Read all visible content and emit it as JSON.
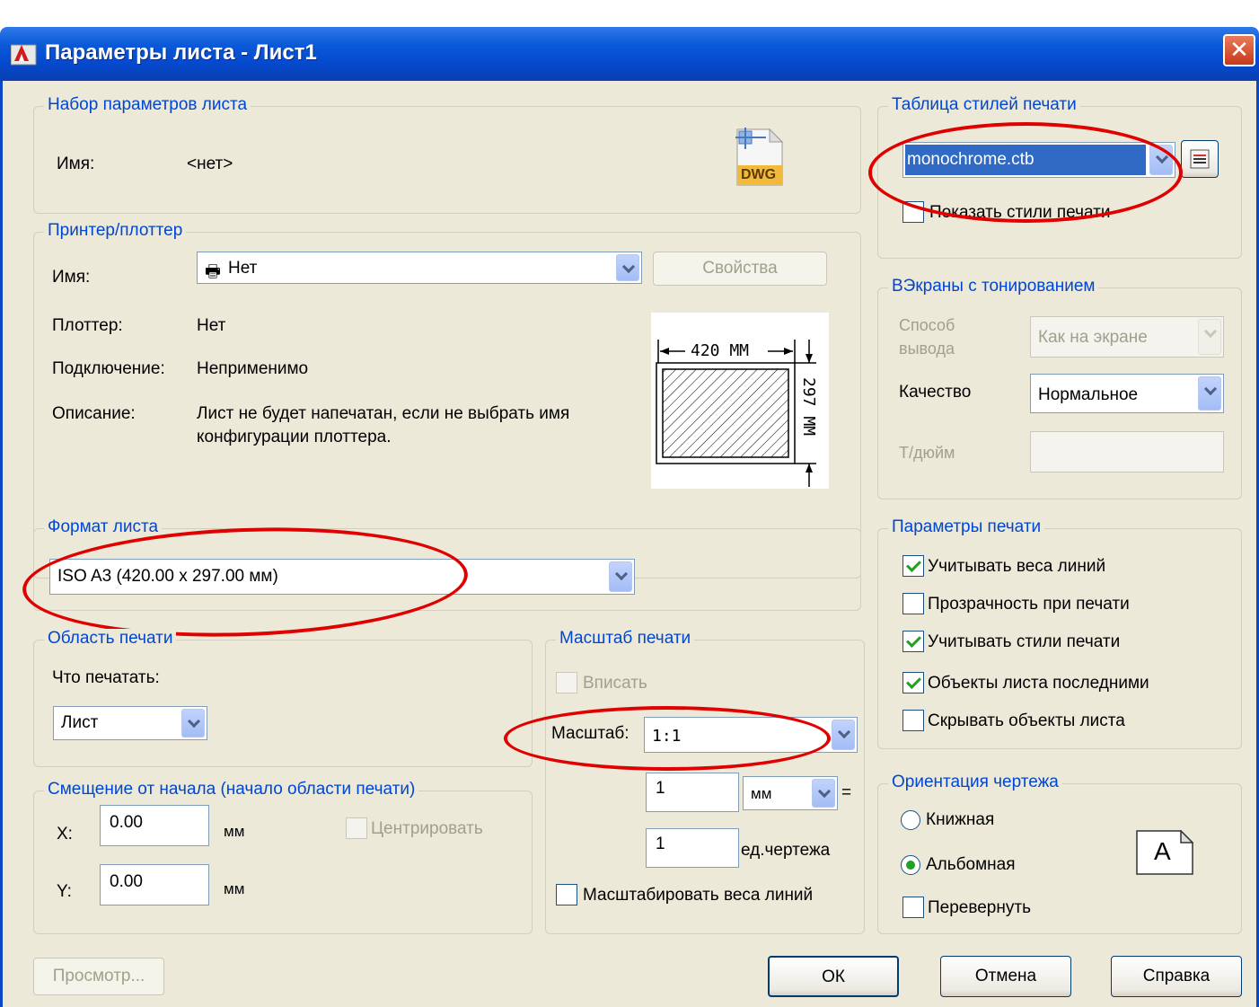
{
  "window": {
    "title": "Параметры листа - Лист1",
    "close": "✕"
  },
  "page_setup": {
    "group": "Набор параметров листа",
    "name_label": "Имя:",
    "name_value": "<нет>",
    "dwg_icon_text": "DWG"
  },
  "printer": {
    "group": "Принтер/плоттер",
    "name_label": "Имя:",
    "name_value": "Нет",
    "properties_button": "Свойства",
    "plotter_label": "Плоттер:",
    "plotter_value": "Нет",
    "connection_label": "Подключение:",
    "connection_value": "Неприменимо",
    "description_label": "Описание:",
    "description_line1": "Лист не будет напечатан, если не выбрать имя",
    "description_line2": "конфигурации плоттера.",
    "preview_width": "420 ММ",
    "preview_height": "297 ММ"
  },
  "paper_size": {
    "group": "Формат листа",
    "value": "ISO A3 (420.00 x 297.00 мм)"
  },
  "plot_area": {
    "group": "Область печати",
    "what_label": "Что печатать:",
    "what_value": "Лист"
  },
  "plot_offset": {
    "group": "Смещение от начала (начало области печати)",
    "x_label": "X:",
    "x_value": "0.00",
    "x_unit": "мм",
    "y_label": "Y:",
    "y_value": "0.00",
    "y_unit": "мм",
    "center_label": "Центрировать"
  },
  "plot_scale": {
    "group": "Масштаб печати",
    "fit_label": "Вписать",
    "scale_label": "Масштаб:",
    "scale_value": "1:1",
    "value1": "1",
    "unit_value": "мм",
    "equals": "=",
    "value2": "1",
    "drawing_units": "ед.чертежа",
    "scale_lineweights": "Масштабировать веса линий"
  },
  "plot_style_table": {
    "group": "Таблица стилей печати",
    "value": "monochrome.ctb",
    "display_styles": "Показать стили печати"
  },
  "shaded_viewport": {
    "group": "ВЭкраны с тонированием",
    "shade_label_1": "Способ",
    "shade_label_2": "вывода",
    "shade_value": "Как на экране",
    "quality_label": "Качество",
    "quality_value": "Нормальное",
    "dpi_label": "Т/дюйм"
  },
  "plot_options": {
    "group": "Параметры печати",
    "items": [
      {
        "label": "Учитывать веса линий",
        "checked": true
      },
      {
        "label": "Прозрачность при печати",
        "checked": false
      },
      {
        "label": "Учитывать стили печати",
        "checked": true
      },
      {
        "label": "Объекты листа последними",
        "checked": true
      },
      {
        "label": "Скрывать объекты листа",
        "checked": false
      }
    ]
  },
  "orientation": {
    "group": "Ориентация чертежа",
    "portrait": "Книжная",
    "landscape": "Альбомная",
    "selected": "landscape",
    "upside_down": "Перевернуть",
    "icon_letter": "A"
  },
  "buttons": {
    "preview": "Просмотр...",
    "ok": "ОК",
    "cancel": "Отмена",
    "help": "Справка"
  },
  "colors": {
    "title_bar": "#0548cc",
    "dialog_bg": "#ece9d8",
    "group_label": "#0046d5",
    "highlight_ellipse": "#e00000",
    "selection": "#316ac5"
  }
}
